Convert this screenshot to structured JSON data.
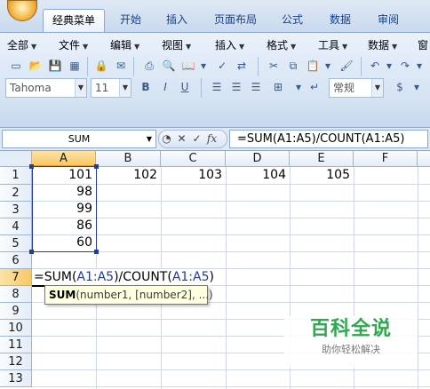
{
  "ribbon": {
    "tabs": [
      "经典菜单",
      "开始",
      "插入",
      "页面布局",
      "公式",
      "数据",
      "审阅"
    ],
    "menu": [
      "全部",
      "文件",
      "编辑",
      "视图",
      "插入",
      "格式",
      "工具",
      "数据",
      "窗"
    ],
    "font_name": "Tahoma",
    "font_size": "11",
    "number_format": "常规"
  },
  "formula_bar": {
    "name_box": "SUM",
    "formula": "=SUM(A1:A5)/COUNT(A1:A5)"
  },
  "grid": {
    "columns": [
      "A",
      "B",
      "C",
      "D",
      "E",
      "F"
    ],
    "rows": [
      "1",
      "2",
      "3",
      "4",
      "5",
      "6",
      "7",
      "8",
      "9",
      "10",
      "11",
      "12",
      "13"
    ],
    "row1": {
      "A": "101",
      "B": "102",
      "C": "103",
      "D": "104",
      "E": "105"
    },
    "colA": [
      "98",
      "99",
      "86",
      "60"
    ],
    "edit_cell": {
      "p1": "=SUM(",
      "ref1": "A1:A5",
      "p2": ")/COUNT(",
      "ref2": "A1:A5",
      "p3": ")"
    }
  },
  "tooltip": {
    "func": "SUM",
    "args": "(number1, [number2], ...)"
  },
  "watermark": {
    "title": "百科全说",
    "subtitle": "助你轻松解决"
  },
  "colors": {
    "ribbon_bg": "#d5e3f3",
    "selected_header": "#f8c964",
    "reference_blue": "#1f3c9e",
    "watermark_green": "#2fa84f"
  }
}
